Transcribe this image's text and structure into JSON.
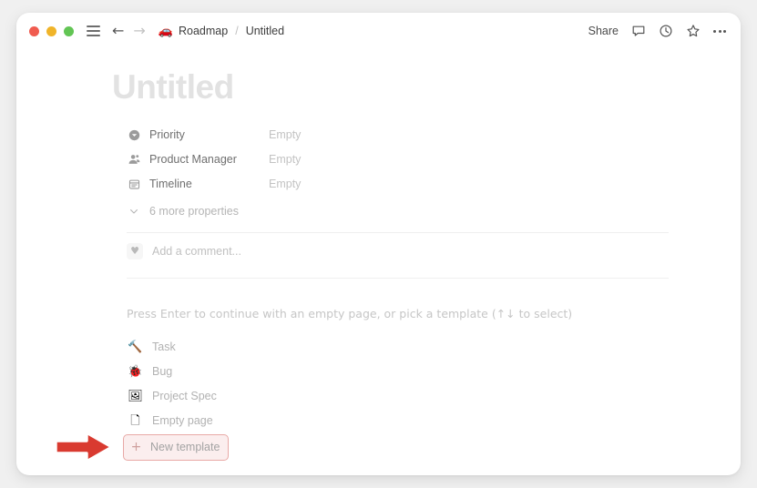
{
  "window": {
    "traffic_lights": [
      "close",
      "minimize",
      "maximize"
    ],
    "colors": {
      "close": "#f05b4f",
      "minimize": "#f0b429",
      "maximize": "#62c554",
      "page_background": "#f0f0f0",
      "window_background": "#ffffff",
      "highlight_border": "#e8a9a6",
      "highlight_fill": "#fbeeee",
      "annotation_arrow": "#d93a30"
    }
  },
  "titlebar": {
    "menu_icon": "hamburger-icon",
    "back_label": "←",
    "forward_label": "→",
    "breadcrumb": {
      "workspace_emoji": "🚗",
      "workspace": "Roadmap",
      "separator": "/",
      "current": "Untitled"
    },
    "share_label": "Share",
    "icons": [
      "comment-icon",
      "history-clock-icon",
      "star-icon",
      "more-options-icon"
    ]
  },
  "document": {
    "title": "Untitled",
    "properties": [
      {
        "icon": "priority-icon",
        "name": "Priority",
        "value": "Empty"
      },
      {
        "icon": "person-icon",
        "name": "Product Manager",
        "value": "Empty"
      },
      {
        "icon": "calendar-icon",
        "name": "Timeline",
        "value": "Empty"
      }
    ],
    "more_properties_label": "6 more properties",
    "comment": {
      "avatar_glyph": "♥",
      "placeholder": "Add a comment..."
    }
  },
  "template_picker": {
    "hint": "Press Enter to continue with an empty page, or pick a template (↑↓ to select)",
    "items": [
      {
        "emoji": "🔨",
        "label": "Task",
        "highlighted": false
      },
      {
        "emoji": "🐞",
        "label": "Bug",
        "highlighted": false
      },
      {
        "emoji": "🖼",
        "label": "Project Spec",
        "highlighted": false
      },
      {
        "emoji": "🗋",
        "label": "Empty page",
        "highlighted": false
      }
    ],
    "new_template": {
      "plus": "+",
      "label": "New template"
    }
  }
}
